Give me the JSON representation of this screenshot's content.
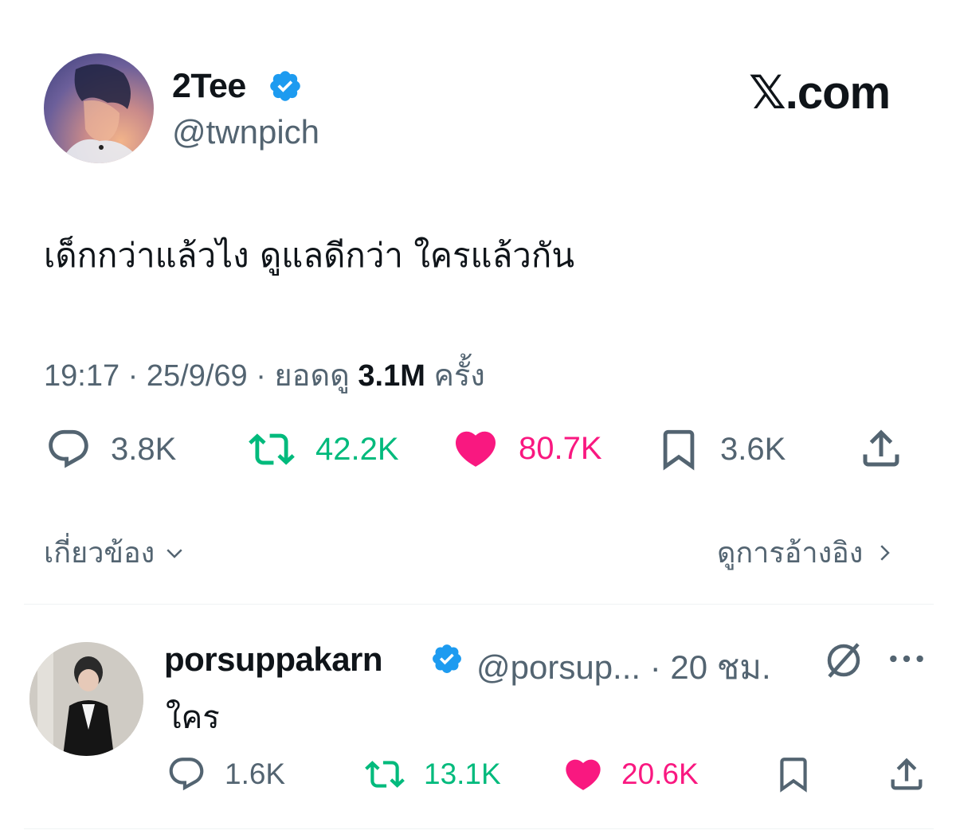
{
  "tweet": {
    "author_name": "2Tee",
    "author_handle": "@twnpich",
    "brand": "𝕏.com",
    "text": "เด็กกว่าแล้วไง ดูแลดีกว่า ใครแล้วกัน",
    "time": "19:17 · 25/9/69 · ยอดดู ",
    "views": "3.1M",
    "views_suffix": " ครั้ง",
    "stats": {
      "replies": "3.8K",
      "reposts": "42.2K",
      "likes": "80.7K",
      "bookmarks": "3.6K"
    },
    "related_label": "เกี่ยวข้อง",
    "quotes_label": "ดูการอ้างอิง"
  },
  "reply": {
    "author_name": "porsuppakarn",
    "author_handle": "@porsup... · 20 ชม.",
    "text": "ใคร",
    "stats": {
      "replies": "1.6K",
      "reposts": "13.1K",
      "likes": "20.6K"
    }
  },
  "colors": {
    "verified": "#1d9bf0",
    "repost": "#00ba7c",
    "like": "#f91880",
    "muted": "#536471"
  }
}
